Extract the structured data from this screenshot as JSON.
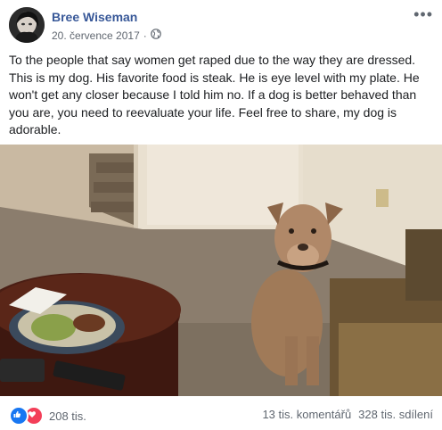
{
  "post": {
    "author": "Bree Wiseman",
    "date": "20. července 2017",
    "separator": "·",
    "privacy_icon": "globe-icon",
    "more_label": "•••",
    "text": "To the people that say women get raped due to the way they are dressed. This is my dog. His favorite food is steak. He is eye level with my plate. He won't get any closer because I told him no. If a dog is better behaved than you are, you need to reevaluate your life. Feel free to share, my dog is adorable."
  },
  "footer": {
    "reaction_icons": [
      "like-icon",
      "love-icon"
    ],
    "reaction_count": "208 tis.",
    "comments": "13 tis. komentářů",
    "shares": "328 tis. sdílení"
  },
  "colors": {
    "author": "#385898",
    "meta": "#606770",
    "like": "#1877f2",
    "love": "#f33e58"
  }
}
